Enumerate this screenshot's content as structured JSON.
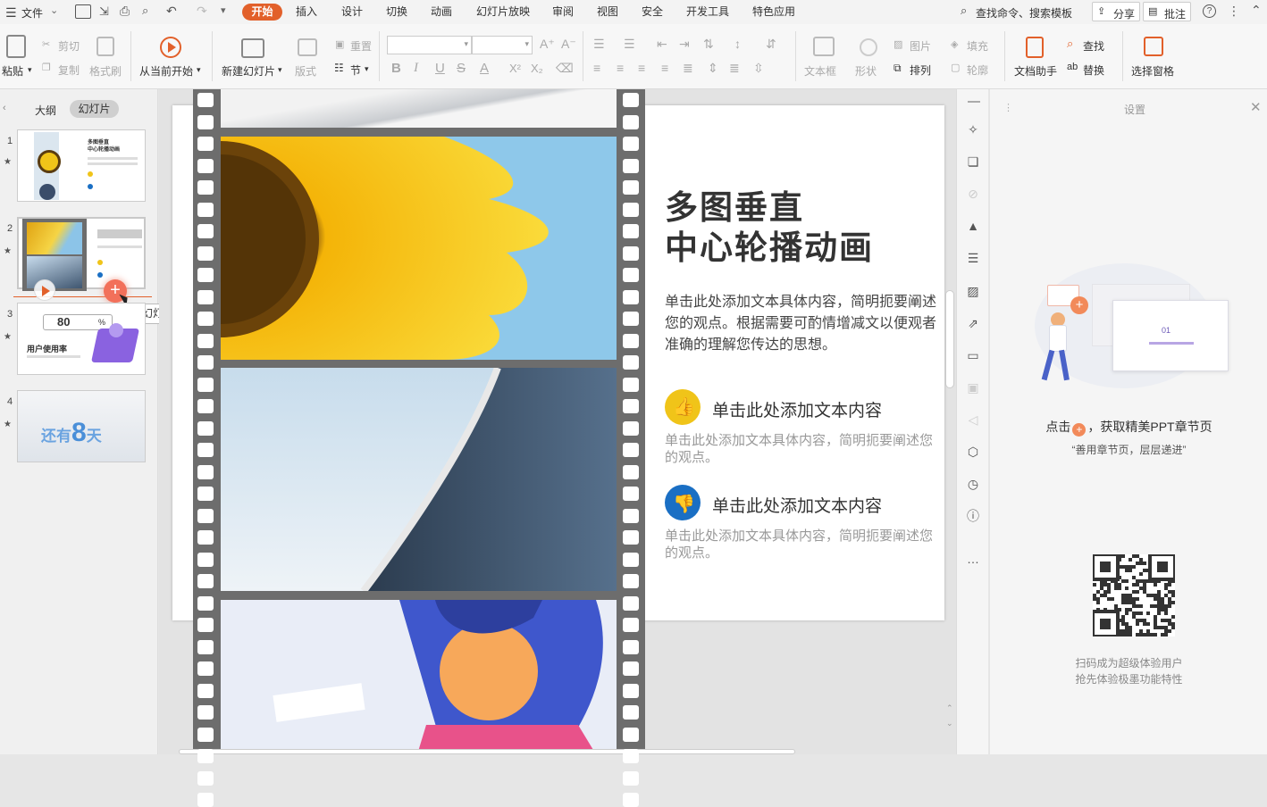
{
  "menubar": {
    "file_label": "文件",
    "tabs": [
      "开始",
      "插入",
      "设计",
      "切换",
      "动画",
      "幻灯片放映",
      "审阅",
      "视图",
      "安全",
      "开发工具",
      "特色应用"
    ],
    "active_tab": "开始",
    "search_label": "查找命令、搜索模板",
    "share_label": "分享",
    "comment_label": "批注",
    "help_icon": "?"
  },
  "ribbon": {
    "paste": "粘贴",
    "cut": "剪切",
    "copy": "复制",
    "format_painter": "格式刷",
    "play_from_current": "从当前开始",
    "new_slide": "新建幻灯片",
    "layout": "版式",
    "reset": "重置",
    "section": "节",
    "font_letters": [
      "B",
      "I",
      "U",
      "S",
      "A",
      "X²",
      "X₂"
    ],
    "text_box": "文本框",
    "shape": "形状",
    "picture": "图片",
    "fill": "填充",
    "arrange": "排列",
    "outline": "轮廓",
    "doc_helper": "文档助手",
    "find": "查找",
    "replace": "替换",
    "select_pane": "选择窗格"
  },
  "leftpanel": {
    "tab_outline": "大纲",
    "tab_slides": "幻灯片",
    "slide_numbers": [
      "1",
      "2",
      "3",
      "4"
    ],
    "thumb1_title": "多图垂直\n中心轮播动画",
    "thumb3_value": "80",
    "thumb3_unit": "%",
    "thumb3_label": "用户使用率",
    "thumb4_text_a": "还有",
    "thumb4_text_b": "8",
    "thumb4_text_c": "天",
    "tooltip": "新建幻灯片"
  },
  "slide": {
    "title_line1": "多图垂直",
    "title_line2": "中心轮播动画",
    "body": "单击此处添加文本具体内容，简明扼要阐述您的观点。根据需要可酌情增减文以便观者准确的理解您传达的思想。",
    "item1_heading": "单击此处添加文本内容",
    "item1_body": "单击此处添加文本具体内容，简明扼要阐述您的观点。",
    "item2_heading": "单击此处添加文本内容",
    "item2_body": "单击此处添加文本具体内容，简明扼要阐述您的观点。"
  },
  "settings": {
    "title": "设置",
    "illus_num": "01",
    "promo_text": "点击",
    "promo_text2": "，获取精美PPT章节页",
    "promo_sub": "“善用章节页，层层递进”",
    "qr_line1": "扫码成为超级体验用户",
    "qr_line2": "抢先体验极墨功能特性"
  },
  "colors": {
    "accent": "#e2602a",
    "thumb_yellow": "#f0c419",
    "thumb_blue": "#1a6fc4",
    "film_gray": "#6d6d6d"
  }
}
